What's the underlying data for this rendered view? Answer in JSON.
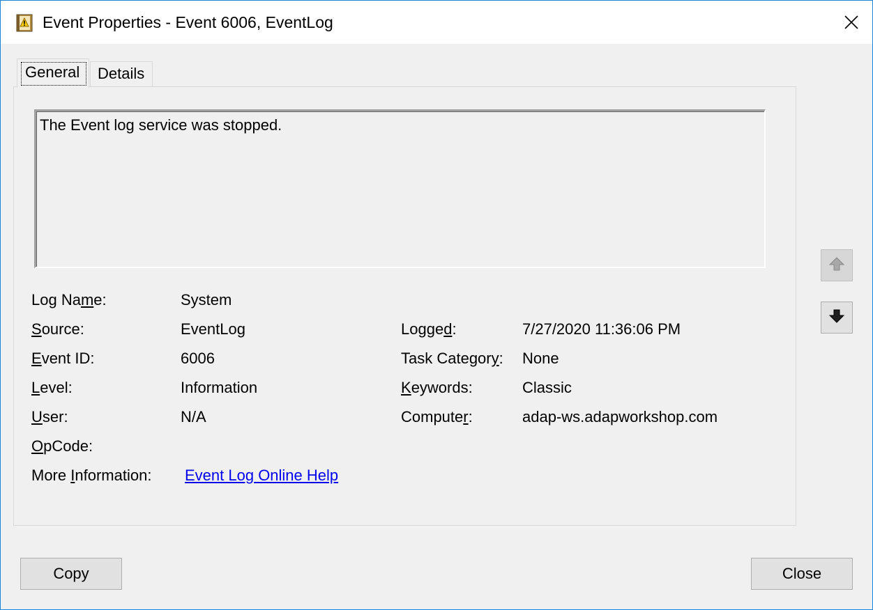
{
  "window": {
    "title": "Event Properties - Event 6006, EventLog"
  },
  "tabs": [
    {
      "label": "General",
      "active": true
    },
    {
      "label": "Details",
      "active": false
    }
  ],
  "description": "The Event log service was stopped.",
  "fields": {
    "log_name": {
      "label": "Log Name:",
      "value": "System"
    },
    "source": {
      "label": "Source:",
      "value": "EventLog"
    },
    "event_id": {
      "label": "Event ID:",
      "value": "6006"
    },
    "level": {
      "label": "Level:",
      "value": "Information"
    },
    "user": {
      "label": "User:",
      "value": "N/A"
    },
    "opcode": {
      "label": "OpCode:",
      "value": ""
    },
    "more_info": {
      "label": "More Information:",
      "value": "Event Log Online Help"
    },
    "logged": {
      "label": "Logged:",
      "value": "7/27/2020 11:36:06 PM"
    },
    "task_category": {
      "label": "Task Category:",
      "value": "None"
    },
    "keywords": {
      "label": "Keywords:",
      "value": "Classic"
    },
    "computer": {
      "label": "Computer:",
      "value": "adap-ws.adapworkshop.com"
    }
  },
  "buttons": {
    "copy": "Copy",
    "close": "Close"
  },
  "icons": {
    "app": "event-log-icon",
    "close": "close-icon",
    "up": "arrow-up-icon",
    "down": "arrow-down-icon"
  },
  "colors": {
    "window_border": "#1883d7",
    "link": "#0000ee",
    "background": "#f0f0f0"
  }
}
